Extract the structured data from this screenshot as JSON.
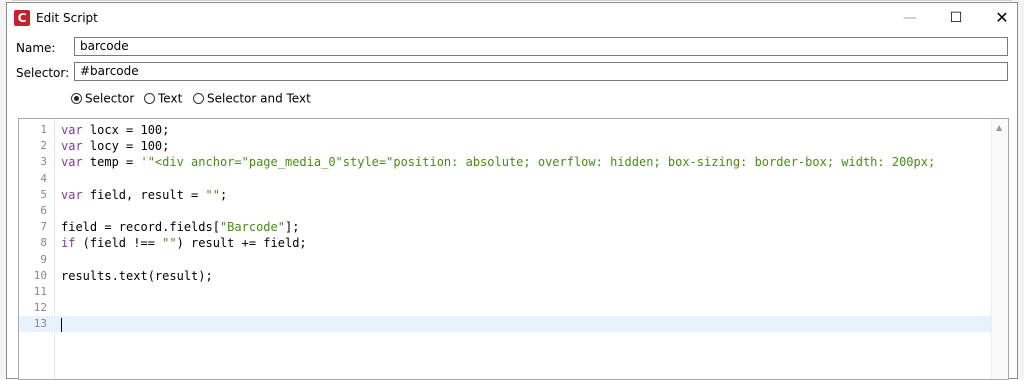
{
  "window": {
    "title": "Edit Script",
    "app_icon_letter": "C",
    "minimize_icon": "minimize-icon",
    "maximize_icon": "maximize-icon",
    "close_icon": "close-icon"
  },
  "form": {
    "name_label": "Name:",
    "name_value": "barcode",
    "selector_label": "Selector:",
    "selector_value": "#barcode"
  },
  "radios": [
    {
      "label": "Selector",
      "selected": true
    },
    {
      "label": "Text",
      "selected": false
    },
    {
      "label": "Selector and Text",
      "selected": false
    }
  ],
  "editor": {
    "lines": [
      {
        "num": "1",
        "tokens": [
          [
            "kw",
            "var"
          ],
          [
            "plain",
            " locx = 100;"
          ]
        ]
      },
      {
        "num": "2",
        "tokens": [
          [
            "kw",
            "var"
          ],
          [
            "plain",
            " locy = 100;"
          ]
        ]
      },
      {
        "num": "3",
        "tokens": [
          [
            "kw",
            "var"
          ],
          [
            "plain",
            " temp = "
          ],
          [
            "str",
            "'\"<div anchor=\"page_media_0\"style=\"position: absolute; overflow: hidden; box-sizing: border-box; width: 200px;"
          ]
        ]
      },
      {
        "num": "4",
        "tokens": []
      },
      {
        "num": "5",
        "tokens": [
          [
            "kw",
            "var"
          ],
          [
            "plain",
            " field, result = "
          ],
          [
            "str",
            "\"\""
          ],
          [
            "plain",
            ";"
          ]
        ]
      },
      {
        "num": "6",
        "tokens": []
      },
      {
        "num": "7",
        "tokens": [
          [
            "plain",
            "field = record.fields["
          ],
          [
            "str",
            "\"Barcode\""
          ],
          [
            "plain",
            "];"
          ]
        ]
      },
      {
        "num": "8",
        "tokens": [
          [
            "kw",
            "if"
          ],
          [
            "plain",
            " (field !== "
          ],
          [
            "str",
            "\"\""
          ],
          [
            "plain",
            ") result += field;"
          ]
        ]
      },
      {
        "num": "9",
        "tokens": []
      },
      {
        "num": "10",
        "tokens": [
          [
            "plain",
            "results.text(result);"
          ]
        ]
      },
      {
        "num": "11",
        "tokens": []
      },
      {
        "num": "12",
        "tokens": []
      },
      {
        "num": "13",
        "tokens": [],
        "active": true
      }
    ]
  }
}
